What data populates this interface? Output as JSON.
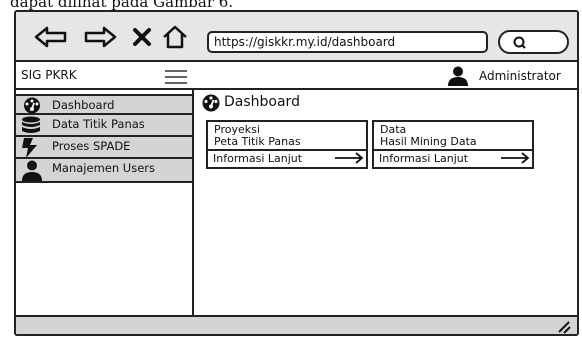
{
  "caption": "dapat dilihat pada Gambar 6.",
  "browser": {
    "url": "https://giskkr.my.id/dashboard",
    "icons": [
      "back-arrow-icon",
      "forward-arrow-icon",
      "close-icon",
      "home-icon",
      "search-icon"
    ]
  },
  "header": {
    "brand": "SIG PKRK",
    "user": "Administrator"
  },
  "sidebar": {
    "items": [
      {
        "label": "Dashboard",
        "icon": "gauge-icon"
      },
      {
        "label": "Data Titik Panas",
        "icon": "database-icon"
      },
      {
        "label": "Proses SPADE",
        "icon": "lightning-icon"
      },
      {
        "label": "Manajemen Users",
        "icon": "user-icon"
      }
    ]
  },
  "main": {
    "title": "Dashboard",
    "cards": [
      {
        "line1": "Proyeksi",
        "line2": "Peta Titik Panas",
        "more": "Informasi Lanjut"
      },
      {
        "line1": "Data",
        "line2": "Hasil Mining Data",
        "more": "Informasi Lanjut"
      }
    ]
  },
  "colors": {
    "chrome": "#e6e6e6",
    "sidebar": "#d4d4d4",
    "stroke": "#222222"
  }
}
